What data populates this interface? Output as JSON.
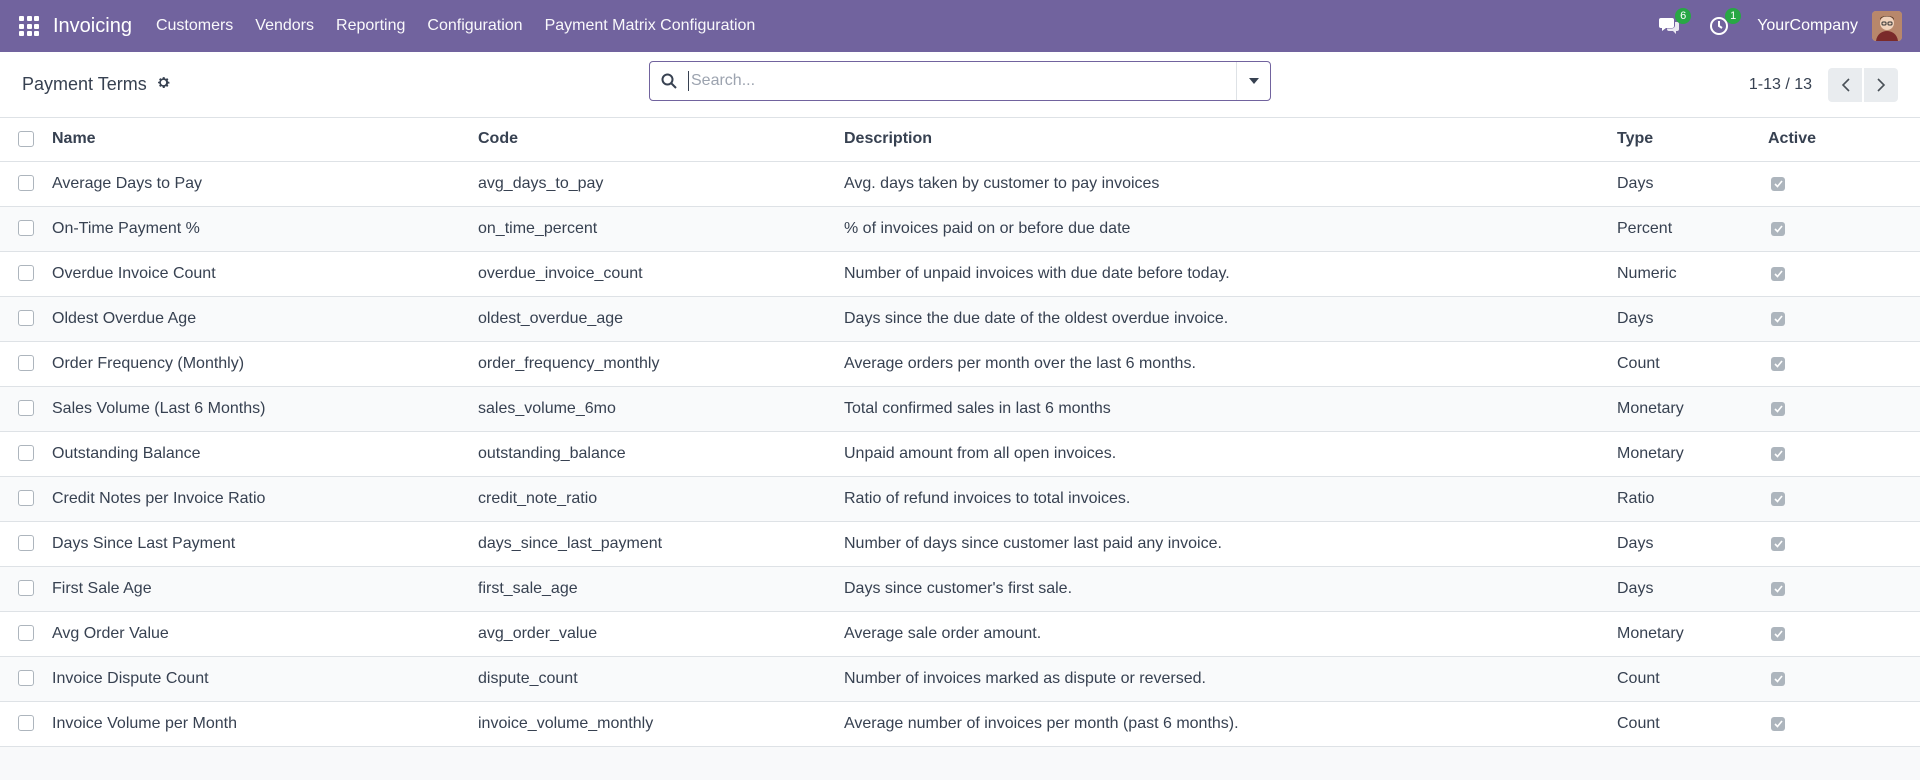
{
  "navbar": {
    "app_name": "Invoicing",
    "menu": [
      "Customers",
      "Vendors",
      "Reporting",
      "Configuration",
      "Payment Matrix Configuration"
    ],
    "messages_count": "6",
    "activities_count": "1",
    "company": "YourCompany"
  },
  "control": {
    "title": "Payment Terms",
    "search_placeholder": "Search...",
    "pager_value": "1-13 / 13"
  },
  "table": {
    "headers": {
      "name": "Name",
      "code": "Code",
      "description": "Description",
      "type": "Type",
      "active": "Active"
    },
    "rows": [
      {
        "name": "Average Days to Pay",
        "code": "avg_days_to_pay",
        "description": "Avg. days taken by customer to pay invoices",
        "type": "Days",
        "active": true
      },
      {
        "name": "On-Time Payment %",
        "code": "on_time_percent",
        "description": "% of invoices paid on or before due date",
        "type": "Percent",
        "active": true
      },
      {
        "name": "Overdue Invoice Count",
        "code": "overdue_invoice_count",
        "description": "Number of unpaid invoices with due date before today.",
        "type": "Numeric",
        "active": true
      },
      {
        "name": "Oldest Overdue Age",
        "code": "oldest_overdue_age",
        "description": "Days since the due date of the oldest overdue invoice.",
        "type": "Days",
        "active": true
      },
      {
        "name": "Order Frequency (Monthly)",
        "code": "order_frequency_monthly",
        "description": "Average orders per month over the last 6 months.",
        "type": "Count",
        "active": true
      },
      {
        "name": "Sales Volume (Last 6 Months)",
        "code": "sales_volume_6mo",
        "description": "Total confirmed sales in last 6 months",
        "type": "Monetary",
        "active": true
      },
      {
        "name": "Outstanding Balance",
        "code": "outstanding_balance",
        "description": "Unpaid amount from all open invoices.",
        "type": "Monetary",
        "active": true
      },
      {
        "name": "Credit Notes per Invoice Ratio",
        "code": "credit_note_ratio",
        "description": "Ratio of refund invoices to total invoices.",
        "type": "Ratio",
        "active": true
      },
      {
        "name": "Days Since Last Payment",
        "code": "days_since_last_payment",
        "description": "Number of days since customer last paid any invoice.",
        "type": "Days",
        "active": true
      },
      {
        "name": "First Sale Age",
        "code": "first_sale_age",
        "description": "Days since customer's first sale.",
        "type": "Days",
        "active": true
      },
      {
        "name": "Avg Order Value",
        "code": "avg_order_value",
        "description": "Average sale order amount.",
        "type": "Monetary",
        "active": true
      },
      {
        "name": "Invoice Dispute Count",
        "code": "dispute_count",
        "description": "Number of invoices marked as dispute or reversed.",
        "type": "Count",
        "active": true
      },
      {
        "name": "Invoice Volume per Month",
        "code": "invoice_volume_monthly",
        "description": "Average number of invoices per month (past 6 months).",
        "type": "Count",
        "active": true
      }
    ]
  },
  "colors": {
    "navbar_bg": "#71639e",
    "badge_bg": "#28a745"
  }
}
